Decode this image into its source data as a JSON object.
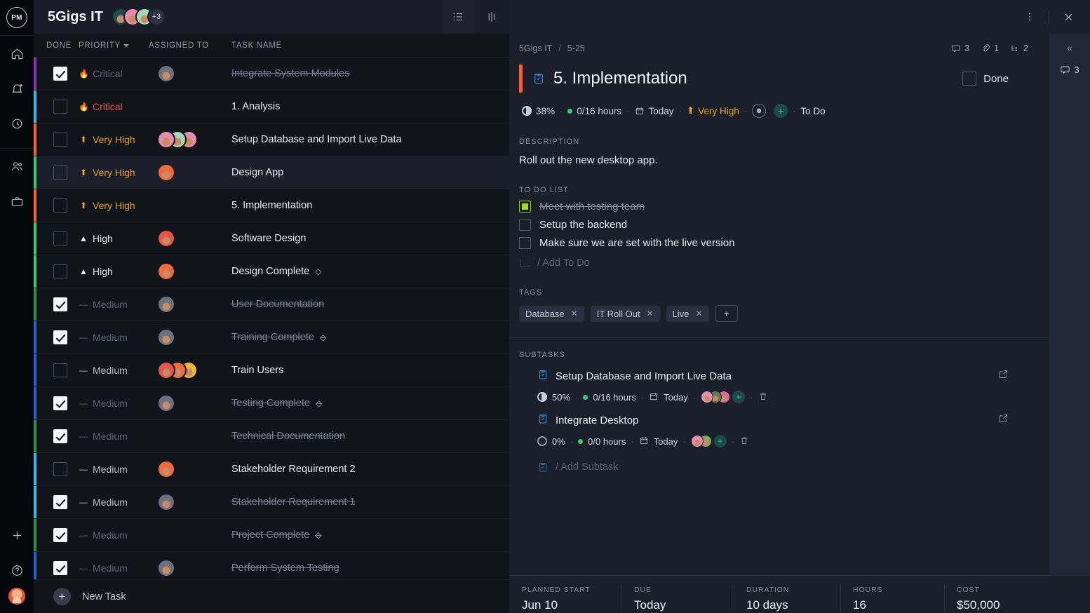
{
  "rail": {
    "logo": "PM",
    "items": [
      {
        "name": "home-icon",
        "label": "Home"
      },
      {
        "name": "bell-icon",
        "label": "Notifications"
      },
      {
        "name": "clock-icon",
        "label": "Time"
      },
      {
        "name": "people-icon",
        "label": "People"
      },
      {
        "name": "briefcase-icon",
        "label": "Workspaces"
      }
    ],
    "bottom": [
      {
        "name": "plus-icon",
        "label": "Add"
      },
      {
        "name": "help-icon",
        "label": "Help"
      },
      {
        "name": "user-avatar",
        "label": "Account"
      }
    ]
  },
  "list": {
    "project_title": "5Gigs IT",
    "avatar_overflow": "+3",
    "avatars": [
      "#1f4d47",
      "#e58ab0",
      "#9fd9b8"
    ],
    "views": [
      {
        "name": "list-view",
        "active": true
      },
      {
        "name": "board-view",
        "active": false
      },
      {
        "name": "gantt-view",
        "active": false
      }
    ],
    "columns": {
      "done": "DONE",
      "priority": "PRIORITY",
      "assigned": "ASSIGNED TO",
      "task": "TASK NAME"
    },
    "new_task_label": "New Task",
    "rows": [
      {
        "done": true,
        "priority": "Critical",
        "prio_class": "p-critical",
        "prio_icon": "🔥",
        "dim": true,
        "assignees": [
          "#6c7180"
        ],
        "task": "Integrate System Modules",
        "struck": true,
        "milestone": false,
        "bar": "#8e2fb0"
      },
      {
        "done": false,
        "priority": "Critical",
        "prio_class": "p-critical",
        "prio_icon": "🔥",
        "dim": false,
        "assignees": [],
        "task": "1. Analysis",
        "struck": false,
        "milestone": false,
        "bar": "#35b7e8"
      },
      {
        "done": false,
        "priority": "Very High",
        "prio_class": "p-veryhigh",
        "prio_icon": "⬆",
        "dim": false,
        "assignees": [
          "#e58ab0",
          "#9fd9b8",
          "#e58ab0"
        ],
        "task": "Setup Database and Import Live Data",
        "struck": false,
        "milestone": false,
        "bar": "#f2633a"
      },
      {
        "done": false,
        "priority": "Very High",
        "prio_class": "p-veryhigh",
        "prio_icon": "⬆",
        "dim": false,
        "assignees": [
          "#ef6b3e"
        ],
        "task": "Design App",
        "struck": false,
        "milestone": false,
        "bar": "#3ec86d",
        "selected": true
      },
      {
        "done": false,
        "priority": "Very High",
        "prio_class": "p-veryhigh",
        "prio_icon": "⬆",
        "dim": false,
        "assignees": [],
        "task": "5. Implementation",
        "struck": false,
        "milestone": false,
        "bar": "#f2633a"
      },
      {
        "done": false,
        "priority": "High",
        "prio_class": "p-high",
        "prio_icon": "▲",
        "dim": false,
        "assignees": [
          "#e2564c"
        ],
        "task": "Software Design",
        "struck": false,
        "milestone": false,
        "bar": "#3ec86d"
      },
      {
        "done": false,
        "priority": "High",
        "prio_class": "p-high",
        "prio_icon": "▲",
        "dim": false,
        "assignees": [
          "#ef6b3e"
        ],
        "task": "Design Complete",
        "struck": false,
        "milestone": true,
        "bar": "#3ec86d"
      },
      {
        "done": true,
        "priority": "Medium",
        "prio_class": "p-medium",
        "prio_icon": "—",
        "dim": true,
        "assignees": [
          "#6c7180"
        ],
        "task": "User Documentation",
        "struck": true,
        "milestone": false,
        "bar": "#2f8f4a"
      },
      {
        "done": true,
        "priority": "Medium",
        "prio_class": "p-medium",
        "prio_icon": "—",
        "dim": true,
        "assignees": [
          "#6c7180"
        ],
        "task": "Training Complete",
        "struck": true,
        "milestone": true,
        "bar": "#2a5fd0"
      },
      {
        "done": false,
        "priority": "Medium",
        "prio_class": "p-medium",
        "prio_icon": "—",
        "dim": false,
        "assignees": [
          "#e2564c",
          "#ef6b3e",
          "#e8b63a"
        ],
        "task": "Train Users",
        "struck": false,
        "milestone": false,
        "bar": "#2a5fd0"
      },
      {
        "done": true,
        "priority": "Medium",
        "prio_class": "p-medium",
        "prio_icon": "—",
        "dim": true,
        "assignees": [
          "#6c7180"
        ],
        "task": "Testing Complete",
        "struck": true,
        "milestone": true,
        "bar": "#2a5fd0"
      },
      {
        "done": true,
        "priority": "Medium",
        "prio_class": "p-medium",
        "prio_icon": "—",
        "dim": true,
        "assignees": [],
        "task": "Technical Documentation",
        "struck": true,
        "milestone": false,
        "bar": "#2f8f4a"
      },
      {
        "done": false,
        "priority": "Medium",
        "prio_class": "p-medium",
        "prio_icon": "—",
        "dim": false,
        "assignees": [
          "#ef6b3e"
        ],
        "task": "Stakeholder Requirement 2",
        "struck": false,
        "milestone": false,
        "bar": "#35b7e8"
      },
      {
        "done": true,
        "priority": "Medium",
        "prio_class": "p-medium",
        "prio_icon": "—",
        "dim": false,
        "assignees": [
          "#6c7180"
        ],
        "task": "Stakeholder Requirement 1",
        "struck": true,
        "milestone": false,
        "bar": "#35b7e8"
      },
      {
        "done": true,
        "priority": "Medium",
        "prio_class": "p-medium",
        "prio_icon": "—",
        "dim": true,
        "assignees": [],
        "task": "Project Complete",
        "struck": true,
        "milestone": true,
        "bar": "#2f8f4a"
      },
      {
        "done": true,
        "priority": "Medium",
        "prio_class": "p-medium",
        "prio_icon": "—",
        "dim": true,
        "assignees": [
          "#6c7180"
        ],
        "task": "Perform System Testing",
        "struck": true,
        "milestone": false,
        "bar": "#2a5fd0"
      }
    ]
  },
  "detail": {
    "breadcrumb_project": "5Gigs IT",
    "breadcrumb_sep": "/",
    "breadcrumb_id": "5-25",
    "counts": {
      "comments": "3",
      "attachments": "1",
      "subtasks": "2"
    },
    "title": "5. Implementation",
    "done_label": "Done",
    "meta": {
      "progress": "38%",
      "hours": "0/16 hours",
      "date": "Today",
      "priority": "Very High",
      "status": "To Do"
    },
    "description_label": "DESCRIPTION",
    "description": "Roll out the new desktop app.",
    "todo_label": "TO DO LIST",
    "todos": [
      {
        "text": "Meet with testing team",
        "done": true
      },
      {
        "text": "Setup the backend",
        "done": false
      },
      {
        "text": "Make sure we are set with the live version",
        "done": false
      }
    ],
    "add_todo_label": "/ Add To Do",
    "tags_label": "TAGS",
    "tags": [
      "Database",
      "IT Roll Out",
      "Live"
    ],
    "tag_add_label": "+",
    "subtasks_label": "SUBTASKS",
    "subtasks": [
      {
        "title": "Setup Database and Import Live Data",
        "progress": "50%",
        "hours": "0/16 hours",
        "date": "Today",
        "avatars": [
          "#e58ab0",
          "#5f7f4e",
          "#e0679a"
        ]
      },
      {
        "title": "Integrate Desktop",
        "progress": "0%",
        "hours": "0/0 hours",
        "date": "Today",
        "avatars": [
          "#e58ab0",
          "#7fa85f"
        ]
      }
    ],
    "add_subtask_label": "/ Add Subtask",
    "right_rail": {
      "collapse": "«",
      "comment_count": "3"
    },
    "footer": [
      {
        "label": "PLANNED START",
        "value": "Jun 10"
      },
      {
        "label": "DUE",
        "value": "Today"
      },
      {
        "label": "DURATION",
        "value": "10 days"
      },
      {
        "label": "HOURS",
        "value": "16"
      },
      {
        "label": "COST",
        "value": "$50,000"
      }
    ]
  }
}
